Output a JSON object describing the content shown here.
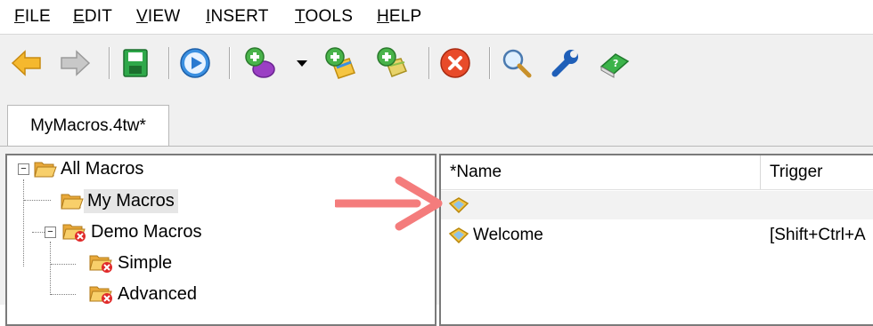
{
  "menu": [
    {
      "accel": "F",
      "rest": "ILE"
    },
    {
      "accel": "E",
      "rest": "DIT"
    },
    {
      "accel": "V",
      "rest": "IEW"
    },
    {
      "accel": "I",
      "rest": "NSERT"
    },
    {
      "accel": "T",
      "rest": "OOLS"
    },
    {
      "accel": "H",
      "rest": "ELP"
    }
  ],
  "toolbar": {
    "icons": [
      "back-arrow-icon",
      "forward-arrow-icon",
      "save-icon",
      "run-play-icon",
      "new-macro-icon",
      "dropdown-icon",
      "new-clip-icon",
      "new-group-icon",
      "delete-icon",
      "search-icon",
      "settings-wrench-icon",
      "help-book-icon"
    ]
  },
  "tab": {
    "label": "MyMacros.4tw*"
  },
  "tree": {
    "items": [
      {
        "label": "All Macros",
        "icon": "folder-open-icon"
      },
      {
        "label": "My Macros",
        "icon": "folder-open-icon"
      },
      {
        "label": "Demo Macros",
        "icon": "folder-disabled-icon"
      },
      {
        "label": "Simple",
        "icon": "folder-disabled-icon"
      },
      {
        "label": "Advanced",
        "icon": "folder-disabled-icon"
      }
    ]
  },
  "list": {
    "columns": [
      "*Name",
      "Trigger"
    ],
    "rows": [
      {
        "name": "",
        "trigger": "",
        "icon": "macro-diamond-icon"
      },
      {
        "name": "Welcome",
        "trigger": "[Shift+Ctrl+A",
        "icon": "macro-diamond-icon"
      }
    ]
  },
  "colors": {
    "annotation_arrow": "#f47c7c",
    "selection": "#e6e6e6"
  }
}
